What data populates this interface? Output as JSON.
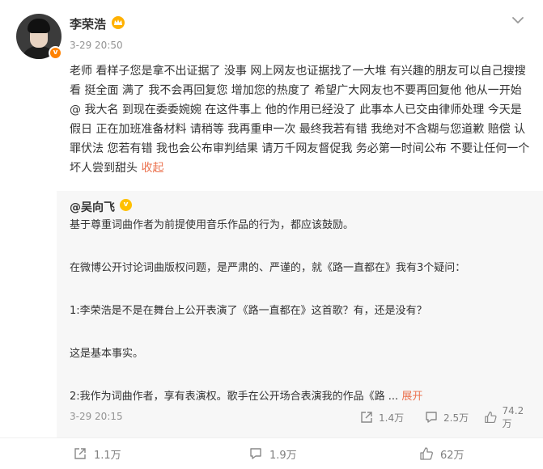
{
  "post": {
    "username": "李荣浩",
    "timestamp": "3-29 20:50",
    "text": "老师 看样子您是拿不出证据了 没事 网上网友也证据找了一大堆 有兴趣的朋友可以自己搜搜看 挺全面 满了 我不会再回复您 增加您的热度了 希望广大网友也不要再回复他 他从一开始@ 我大名 到现在委委婉婉 在这件事上 他的作用已经没了 此事本人已交由律师处理 今天是假日 正在加班准备材料 请稍等 我再重申一次 最终我若有错 我绝对不含糊与您道歉 赔偿 认罪伏法 您若有错 我也会公布审判结果 请万千网友督促我 务必第一时间公布 不要让任何一个坏人尝到甜头 ",
    "collapse_label": "收起"
  },
  "repost": {
    "author": "@吴向飞",
    "paragraphs": [
      "基于尊重词曲作者为前提使用音乐作品的行为，都应该鼓励。",
      "在微博公开讨论词曲版权问题，是严肃的、严谨的，就《路一直都在》我有3个疑问：",
      "1:李荣浩是不是在舞台上公开表演了《路一直都在》这首歌？有，还是没有？",
      "这是基本事实。",
      "2:我作为词曲作者，享有表演权。歌手在公开场合表演我的作品《路 ..."
    ],
    "expand_label": "展开",
    "timestamp": "3-29 20:15",
    "reposts": "1.4万",
    "comments": "2.5万",
    "likes": "74.2万"
  },
  "actions": {
    "reposts": "1.1万",
    "comments": "1.9万",
    "likes": "62万"
  },
  "colors": {
    "accent": "#eb7350",
    "verified": "#ff8200",
    "gold_v": "#ffc000"
  }
}
